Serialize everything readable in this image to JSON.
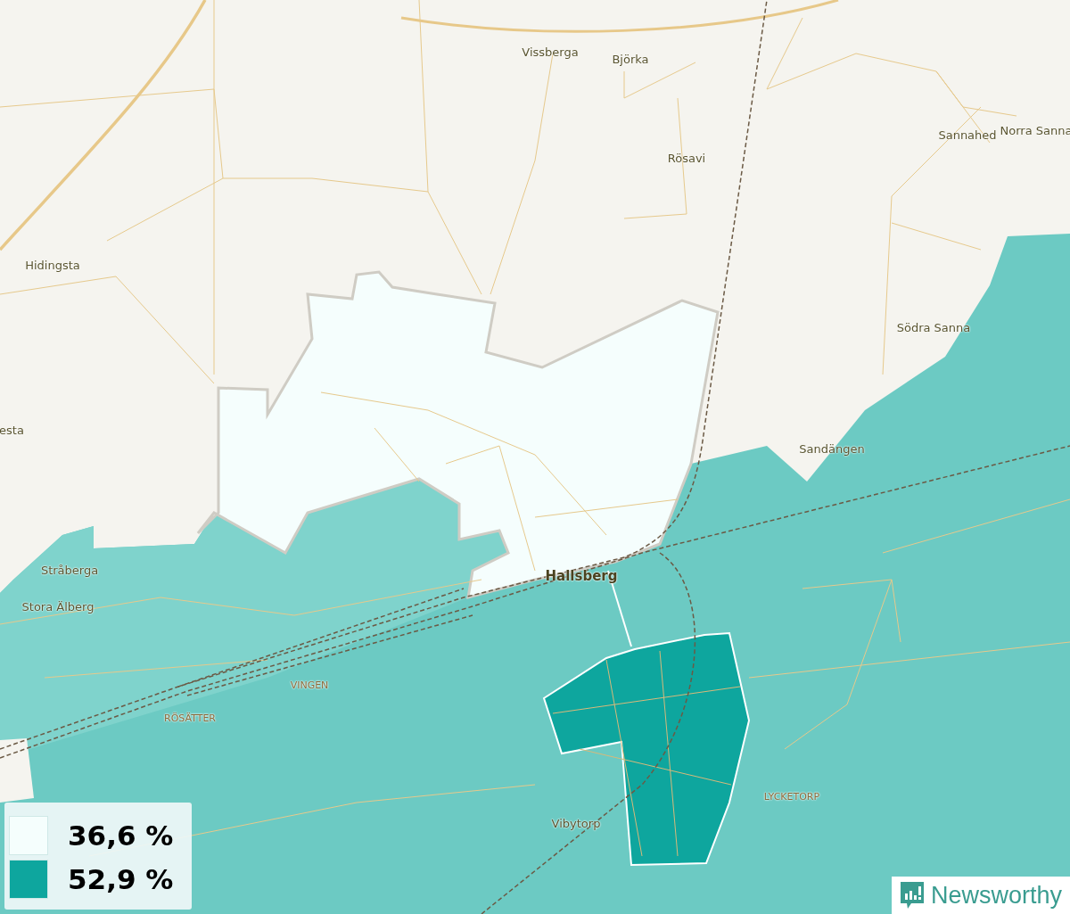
{
  "map": {
    "labels": [
      {
        "text": "Vissberga",
        "kind": "place"
      },
      {
        "text": "Björka",
        "kind": "place"
      },
      {
        "text": "Rösavi",
        "kind": "place"
      },
      {
        "text": "Sannahed",
        "kind": "place"
      },
      {
        "text": "Norra Sanna",
        "kind": "place"
      },
      {
        "text": "Hidingsta",
        "kind": "place"
      },
      {
        "text": "Södra Sanna",
        "kind": "place"
      },
      {
        "text": "esta",
        "kind": "place"
      },
      {
        "text": "Sandängen",
        "kind": "place"
      },
      {
        "text": "Stråberga",
        "kind": "place"
      },
      {
        "text": "Hallsberg",
        "kind": "town"
      },
      {
        "text": "Stora Älberg",
        "kind": "place"
      },
      {
        "text": "VINGEN",
        "kind": "district"
      },
      {
        "text": "RÖSÄTTER",
        "kind": "district"
      },
      {
        "text": "LYCKETORP",
        "kind": "district"
      },
      {
        "text": "Vibytorp",
        "kind": "place"
      }
    ]
  },
  "legend": [
    {
      "value": "36,6 %",
      "color": "#f5fefd"
    },
    {
      "value": "52,9 %",
      "color": "#0ea69e"
    }
  ],
  "logo": {
    "text": "Newsworthy"
  }
}
